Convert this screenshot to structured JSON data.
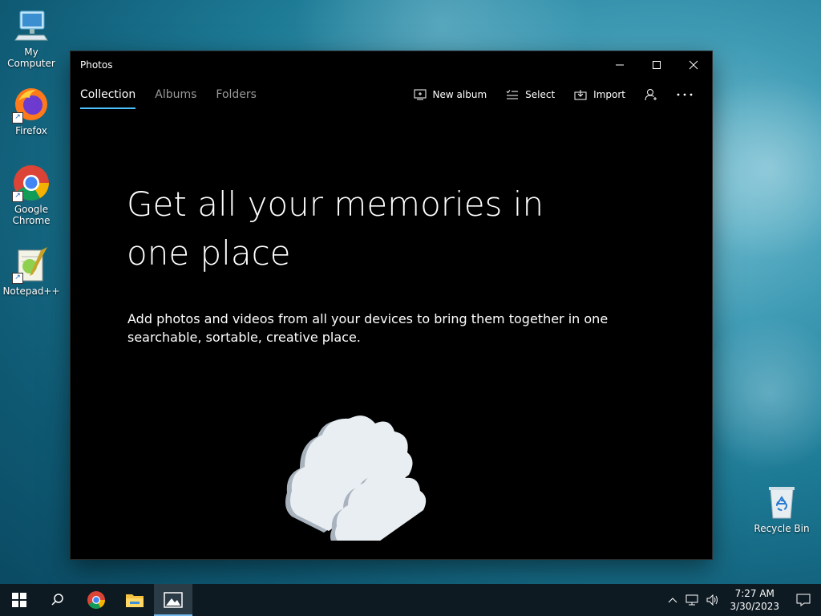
{
  "desktop": {
    "icons": [
      {
        "label": "My Computer"
      },
      {
        "label": "Firefox"
      },
      {
        "label": "Google Chrome"
      },
      {
        "label": "Notepad++"
      },
      {
        "label": "Recycle Bin"
      }
    ]
  },
  "window": {
    "title": "Photos",
    "tabs": [
      {
        "label": "Collection",
        "active": true
      },
      {
        "label": "Albums",
        "active": false
      },
      {
        "label": "Folders",
        "active": false
      }
    ],
    "actions": {
      "new_album": "New album",
      "select": "Select",
      "import": "Import"
    },
    "hero": {
      "heading": "Get all your memories in one place",
      "subtext": "Add photos and videos from all your devices to bring them together in one searchable, sortable, creative place."
    },
    "accent_color": "#4cc2ff"
  },
  "taskbar": {
    "clock": {
      "time": "7:27 AM",
      "date": "3/30/2023"
    }
  }
}
